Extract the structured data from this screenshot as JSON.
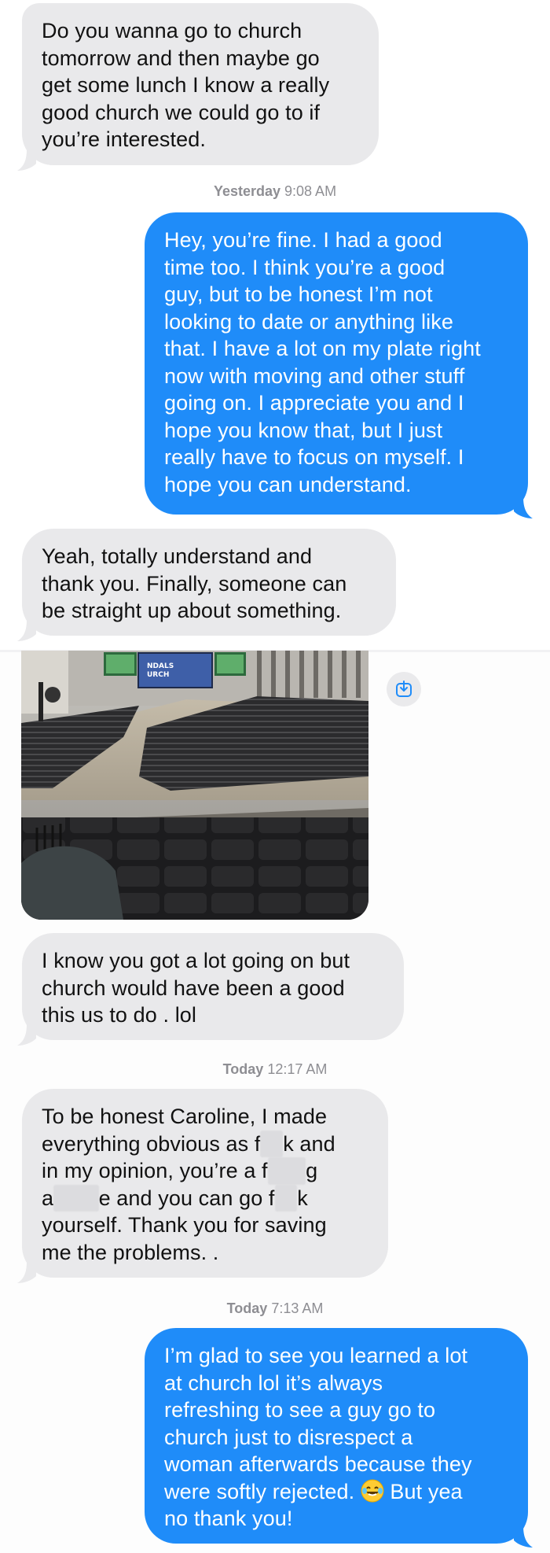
{
  "messages": {
    "m1": "Do you wanna go to church\ntomorrow and then maybe go\nget some lunch I know a really\ngood church we could go to if\nyou’re interested.",
    "m2": "Hey, you’re fine. I had a good\ntime too. I think you’re a good\nguy, but to be honest I’m not\nlooking to date or anything like\nthat. I have a lot on my plate right\nnow with moving and other stuff\ngoing on. I appreciate you and I\nhope you know that, but I just\nreally have to focus on myself. I\nhope you can understand.",
    "m3": "Yeah, totally understand and\nthank you. Finally, someone can\nbe straight up about something.",
    "m4": "I know you got a lot going on but\nchurch would have been a good\nthis us to do . lol",
    "m5": {
      "line1": "To be honest Caroline, I made",
      "line2a": "everything obvious as f",
      "line2b": "k and",
      "line3a": "in my opinion, you’re a f",
      "line3b": "g",
      "line4a": "a",
      "line4b": "e and you can go f",
      "line4c": "k",
      "line5": "yourself. Thank you for saving",
      "line6": "me the problems. ."
    },
    "m6": {
      "body": "I’m glad to see you learned a lot\nat church lol it’s always\nrefreshing to see a guy go to\nchurch just to disrespect a\nwoman afterwards because they\nwere softly rejected. ",
      "after_emoji": " But yea",
      "last": "no thank you!"
    }
  },
  "timestamps": {
    "t1": {
      "day": "Yesterday",
      "time": "9:08 AM"
    },
    "t2": {
      "day": "Today",
      "time": "12:17 AM"
    },
    "t3": {
      "day": "Today",
      "time": "7:13 AM"
    }
  },
  "photo": {
    "sign_text": "NDALS\nURCH"
  },
  "icons": {
    "save": "save-to-photos-icon",
    "emoji": "laughing-tears-emoji-icon"
  },
  "colors": {
    "incoming": "#e9e9eb",
    "outgoing": "#1f8cf9",
    "timestamp": "#8e8e93"
  }
}
